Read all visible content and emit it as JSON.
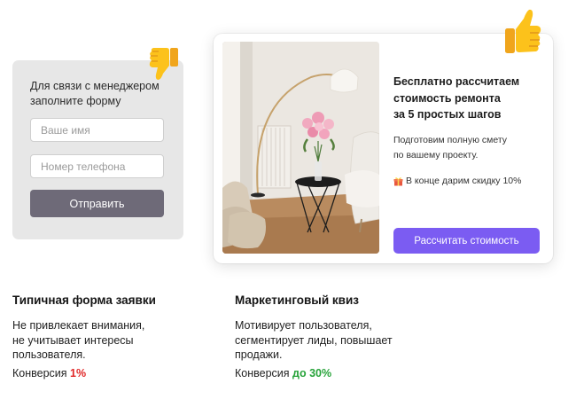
{
  "typical_form": {
    "title": "Для связи с менеджером заполните форму",
    "name_placeholder": "Ваше имя",
    "phone_placeholder": "Номер телефона",
    "submit_label": "Отправить",
    "reaction_icon": "thumbs-down-icon"
  },
  "quiz": {
    "headline_lines": [
      "Бесплатно рассчитаем",
      "стоимость ремонта",
      "за 5 простых шагов"
    ],
    "sub_lines": [
      "Подготовим полную смету",
      "по вашему проекту."
    ],
    "gift_text": "В конце дарим скидку 10%",
    "gift_icon": "gift-icon",
    "button_label": "Рассчитать стоимость",
    "photo": "interior-photo",
    "reaction_icon": "thumbs-up-icon"
  },
  "captions": {
    "left": {
      "title": "Типичная форма заявки",
      "desc_lines": [
        "Не привлекает внимания,",
        "не учитывает интересы",
        "пользователя."
      ],
      "conversion_label": "Конверсия",
      "conversion_value": "1%"
    },
    "right": {
      "title": "Маркетинговый квиз",
      "desc_lines": [
        "Мотивирует пользователя,",
        "сегментирует лиды, повышает",
        "продажи."
      ],
      "conversion_label": "Конверсия",
      "conversion_value": "до 30%"
    }
  },
  "colors": {
    "form_background": "#e7e7e7",
    "form_button": "#6e6a78",
    "quiz_button": "#7b5cf2",
    "conversion_low": "#e02727",
    "conversion_high": "#27a33a"
  }
}
